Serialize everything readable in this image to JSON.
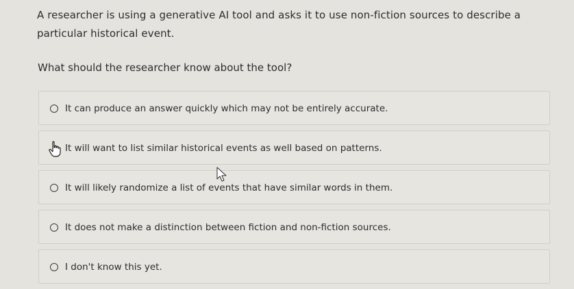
{
  "question": {
    "text": "A researcher is using a generative AI tool and asks it to use non-fiction sources to describe a particular historical event.",
    "prompt": "What should the researcher know about the tool?"
  },
  "options": [
    {
      "label": "It can produce an answer quickly which may not be entirely accurate."
    },
    {
      "label": "It will want to list similar historical events as well based on patterns."
    },
    {
      "label": "It will likely randomize a list of events that have similar words in them."
    },
    {
      "label": "It does not make a distinction between fiction and non-fiction sources."
    },
    {
      "label": "I don't know this yet."
    }
  ],
  "icons": {
    "radio": "radio-button-icon",
    "hand_cursor": "hand-pointer-cursor-icon",
    "arrow_cursor": "arrow-pointer-cursor-icon"
  }
}
